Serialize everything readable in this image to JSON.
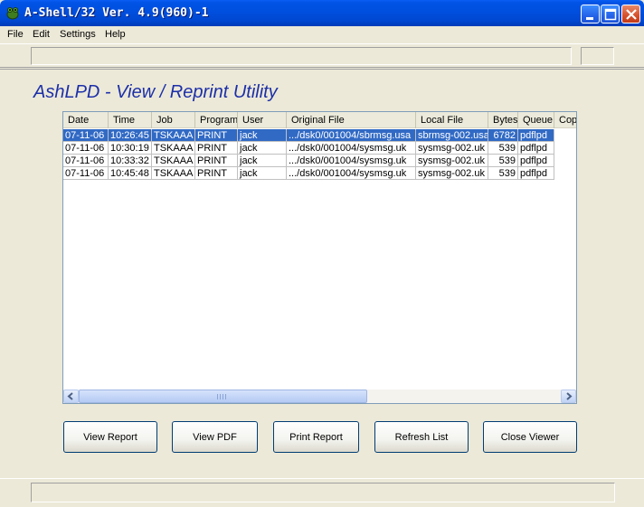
{
  "window": {
    "title": "A-Shell/32 Ver. 4.9(960)-1",
    "app_icon": "frog-icon",
    "controls": {
      "minimize_icon": "minimize-icon",
      "maximize_icon": "maximize-icon",
      "close_icon": "close-icon"
    }
  },
  "menu": {
    "items": [
      "File",
      "Edit",
      "Settings",
      "Help"
    ]
  },
  "heading": "AshLPD - View / Reprint Utility",
  "table": {
    "columns": [
      "Date",
      "Time",
      "Job",
      "Program",
      "User",
      "Original File",
      "Local File",
      "Bytes",
      "Queue",
      "Cop"
    ],
    "rows": [
      [
        "07-11-06",
        "10:26:45",
        "TSKAAA",
        "PRINT",
        "jack",
        ".../dsk0/001004/sbrmsg.usa",
        "sbrmsg-002.usa",
        "6782",
        "pdflpd",
        ""
      ],
      [
        "07-11-06",
        "10:30:19",
        "TSKAAA",
        "PRINT",
        "jack",
        ".../dsk0/001004/sysmsg.uk",
        "sysmsg-002.uk",
        "539",
        "pdflpd",
        ""
      ],
      [
        "07-11-06",
        "10:33:32",
        "TSKAAA",
        "PRINT",
        "jack",
        ".../dsk0/001004/sysmsg.uk",
        "sysmsg-002.uk",
        "539",
        "pdflpd",
        ""
      ],
      [
        "07-11-06",
        "10:45:48",
        "TSKAAA",
        "PRINT",
        "jack",
        ".../dsk0/001004/sysmsg.uk",
        "sysmsg-002.uk",
        "539",
        "pdflpd",
        ""
      ]
    ],
    "selected_row": 0
  },
  "buttons": {
    "view_report": "View Report",
    "view_pdf": "View PDF",
    "print_report": "Print Report",
    "refresh_list": "Refresh List",
    "close_viewer": "Close Viewer"
  },
  "colors": {
    "heading": "#1c2fa8",
    "selection": "#316ac5",
    "titlebar": "#0050e0"
  }
}
